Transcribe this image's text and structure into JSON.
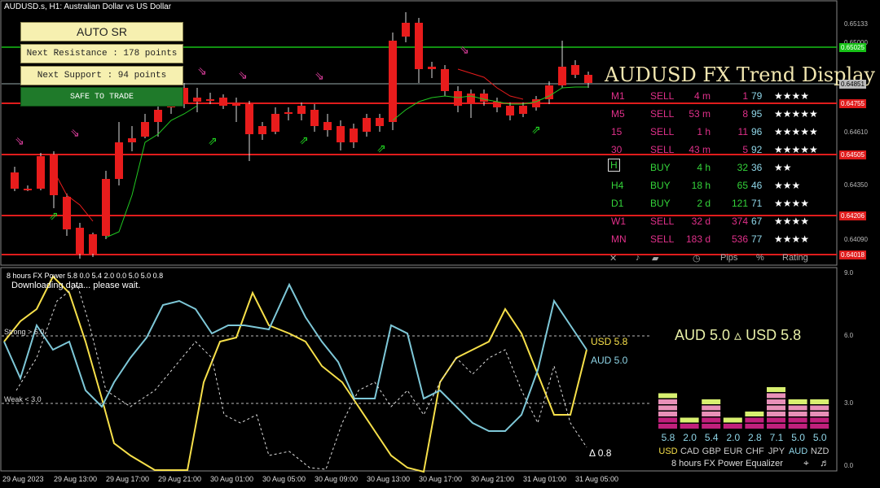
{
  "symbol_title": "AUDUSD.s, H1: Australian Dollar vs US Dollar",
  "auto_sr": {
    "title": "AUTO SR",
    "next_resistance": "Next Resistance : 178 points",
    "next_support": "Next Support : 94 points",
    "safe": "SAFE TO TRADE"
  },
  "trend_display": {
    "title": "AUDUSD FX Trend Display",
    "rows": [
      {
        "tf": "M1",
        "dir": "SELL",
        "age": "4 m",
        "pips": "1",
        "pct": "79",
        "stars": "★★★★"
      },
      {
        "tf": "M5",
        "dir": "SELL",
        "age": "53 m",
        "pips": "8",
        "pct": "95",
        "stars": "★★★★★"
      },
      {
        "tf": "15",
        "dir": "SELL",
        "age": "1 h",
        "pips": "11",
        "pct": "96",
        "stars": "★★★★★"
      },
      {
        "tf": "30",
        "dir": "SELL",
        "age": "43 m",
        "pips": "5",
        "pct": "92",
        "stars": "★★★★★"
      },
      {
        "tf": "H",
        "dir": "BUY",
        "age": "4 h",
        "pips": "32",
        "pct": "36",
        "stars": "★★"
      },
      {
        "tf": "H4",
        "dir": "BUY",
        "age": "18 h",
        "pips": "65",
        "pct": "46",
        "stars": "★★★"
      },
      {
        "tf": "D1",
        "dir": "BUY",
        "age": "2 d",
        "pips": "121",
        "pct": "71",
        "stars": "★★★★"
      },
      {
        "tf": "W1",
        "dir": "SELL",
        "age": "32 d",
        "pips": "374",
        "pct": "67",
        "stars": "★★★★"
      },
      {
        "tf": "MN",
        "dir": "SELL",
        "age": "183 d",
        "pips": "536",
        "pct": "77",
        "stars": "★★★★"
      }
    ],
    "header": {
      "close": "✕",
      "sound": "♪",
      "clock": "◷",
      "pips": "Pips",
      "pct": "%",
      "rating": "Rating"
    },
    "icons": {
      "close": "close-icon",
      "sound": "music-note-icon",
      "trend": "trend-icon",
      "clock": "clock-icon"
    },
    "colors": {
      "sell": "#e0308a",
      "buy": "#34d43a",
      "stars": "#ffffff"
    }
  },
  "price_axis": [
    "0.65133",
    "0.65000",
    "0.64851",
    "0.64755",
    "0.64610",
    "0.64505",
    "0.64350",
    "0.64206",
    "0.64090",
    "0.64018"
  ],
  "price_tags": [
    {
      "label": "0.65025",
      "color": "#17c117"
    },
    {
      "label": "0.64851",
      "color": "#bbbbbb"
    },
    {
      "label": "0.64755",
      "color": "#e01c1c"
    },
    {
      "label": "0.64505",
      "color": "#e01c1c"
    },
    {
      "label": "0.64206",
      "color": "#e01c1c"
    },
    {
      "label": "0.64018",
      "color": "#e01c1c"
    }
  ],
  "indicator": {
    "title": "8 hours FX Power 5.8 0.0 5.4 2.0 0.0 5.0 5.0 0.8",
    "status": "Downloading data... please wait.",
    "strong_label": "Strong > 6.0",
    "weak_label": "Weak < 3.0",
    "usd_label": "USD 5.8",
    "aud_label": "AUD 5.0",
    "delta_label": "Δ 0.8",
    "pair_text": "AUD 5.0  ▵  USD 5.8",
    "axis": [
      "9.0",
      "6.0",
      "3.0",
      "0.0"
    ]
  },
  "equalizer": {
    "currencies": [
      "USD",
      "CAD",
      "GBP",
      "EUR",
      "CHF",
      "JPY",
      "AUD",
      "NZD"
    ],
    "values": [
      "5.8",
      "2.0",
      "5.4",
      "2.0",
      "2.8",
      "7.1",
      "5.0",
      "5.0"
    ],
    "footer": "8 hours   FX Power  Equalizer",
    "footer_icons": [
      "crosshair-icon",
      "music-note-icon"
    ],
    "colors": {
      "high": "#d8f070",
      "mid": "#e890b8",
      "low": "#c0207c",
      "usd": "#f7e04a",
      "aud": "#8fd6e8"
    }
  },
  "time_axis": [
    "29 Aug 2023",
    "29 Aug 13:00",
    "29 Aug 17:00",
    "29 Aug 21:00",
    "30 Aug 01:00",
    "30 Aug 05:00",
    "30 Aug 09:00",
    "30 Aug 13:00",
    "30 Aug 17:00",
    "30 Aug 21:00",
    "31 Aug 01:00",
    "31 Aug 05:00"
  ]
}
